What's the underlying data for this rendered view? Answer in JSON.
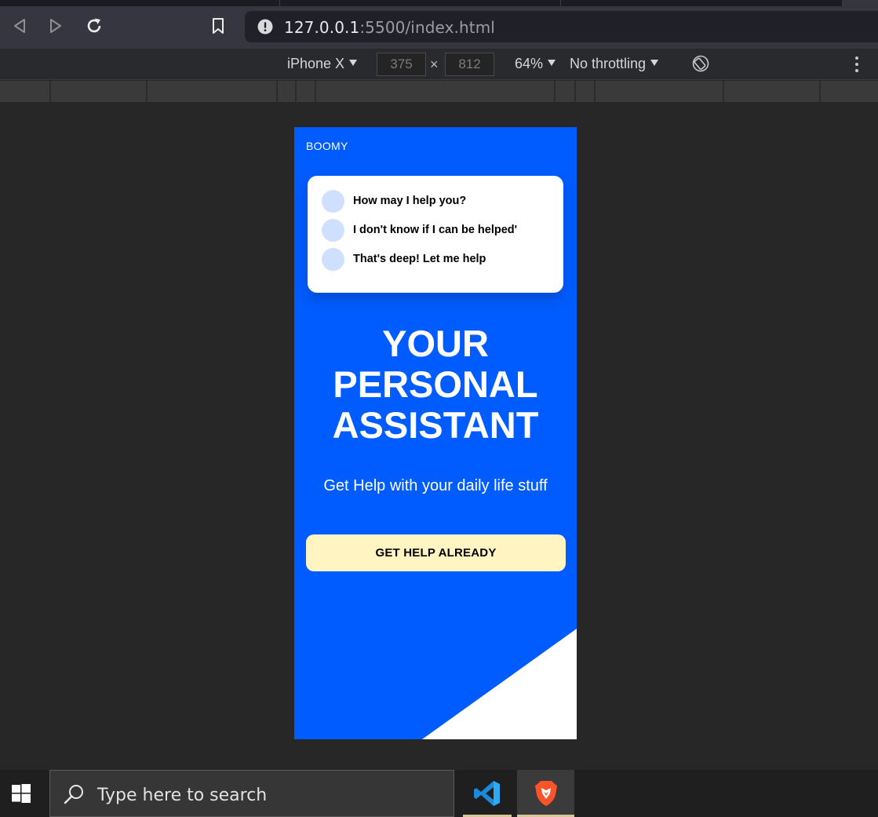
{
  "browser": {
    "url_host": "127.0.0.1",
    "url_rest": ":5500/index.html"
  },
  "devtools": {
    "device": "iPhone X",
    "width": "375",
    "height": "812",
    "times": "×",
    "zoom": "64%",
    "throttling": "No throttling"
  },
  "page": {
    "brand": "BOOMY",
    "chat": [
      {
        "text": "How may I help you?"
      },
      {
        "text": "I don't know if I can be helped'"
      },
      {
        "text": "That's deep! Let me help"
      }
    ],
    "headline_lines": [
      "YOUR",
      "PERSONAL",
      "ASSISTANT"
    ],
    "subtitle": "Get Help with your daily life stuff",
    "cta": "GET HELP ALREADY",
    "colors": {
      "background": "#005cff",
      "cta": "#fff4c2",
      "avatar": "#cfe0ff"
    }
  },
  "taskbar": {
    "search_placeholder": "Type here to search",
    "apps": [
      {
        "icon": "vscode-icon"
      },
      {
        "icon": "brave-icon"
      }
    ]
  }
}
